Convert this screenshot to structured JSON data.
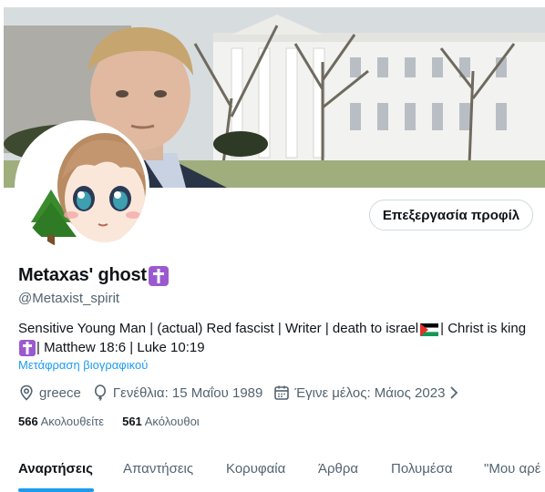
{
  "profile": {
    "display_name": "Metaxas' ghost",
    "handle": "@Metaxist_spirit",
    "edit_button": "Επεξεργασία προφίλ",
    "bio": {
      "line1_part1": "Sensitive Young Man | (actual) Red fascist | Writer | death to israel",
      "line1_part2": " | Christ is king",
      "line2": " | Matthew 18:6 | Luke 10:19"
    },
    "translate_bio": "Μετάφραση βιογραφικού",
    "location": "greece",
    "birthday": "Γενέθλια: 15 Μαΐου 1989",
    "joined": "Έγινε μέλος: Μάιος 2023",
    "following_count": "566",
    "following_label": "Ακολουθείτε",
    "followers_count": "561",
    "followers_label": "Ακόλουθοι",
    "badge_icon": "latin-cross-emoji",
    "flag_icon": "palestine-flag-emoji"
  },
  "tabs": [
    {
      "label": "Αναρτήσεις",
      "active": true
    },
    {
      "label": "Απαντήσεις",
      "active": false
    },
    {
      "label": "Κορυφαία",
      "active": false
    },
    {
      "label": "Άρθρα",
      "active": false
    },
    {
      "label": "Πολυμέσα",
      "active": false
    },
    {
      "label": "\"Μου αρέ",
      "active": false
    }
  ],
  "colors": {
    "accent": "#1d9bf0",
    "text_primary": "#0f1419",
    "text_secondary": "#536471",
    "badge_purple": "#9b59d0"
  }
}
